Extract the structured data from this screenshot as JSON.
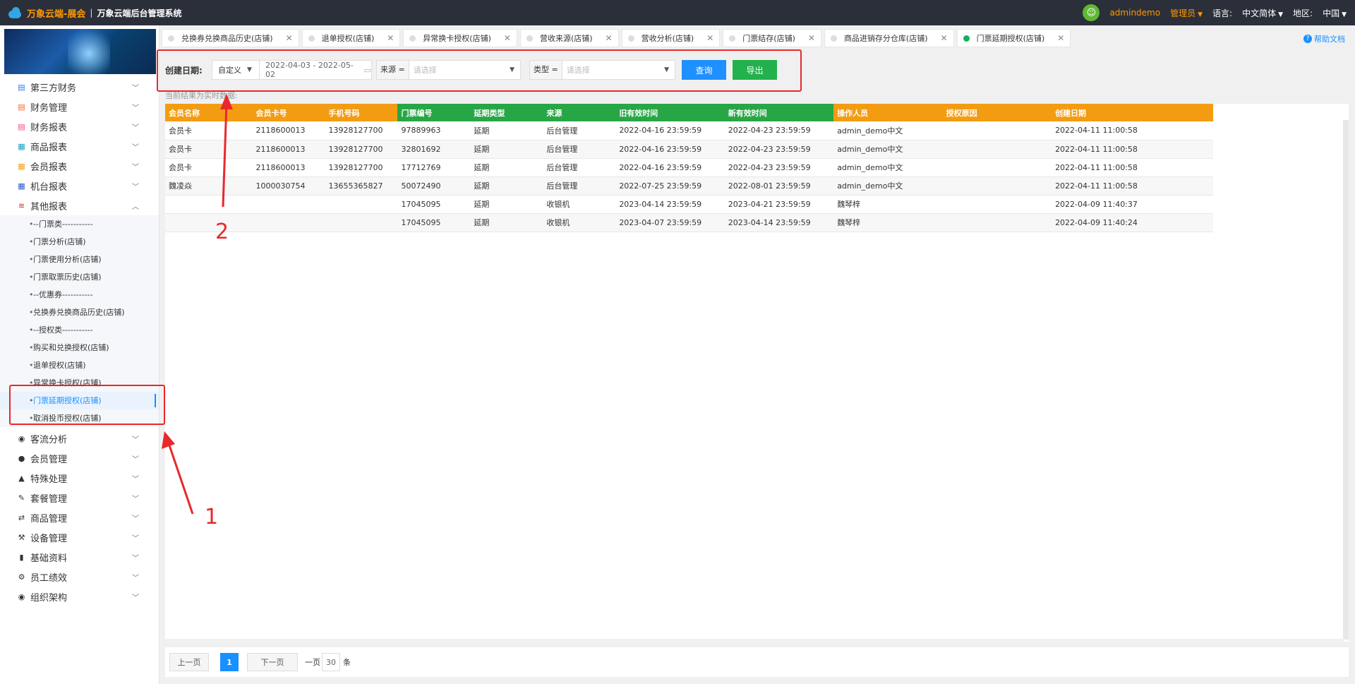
{
  "header": {
    "brand": "万象云端-展会",
    "separator": "|",
    "system_name": "万象云端后台管理系统",
    "avatar_glyph": "☺",
    "username": "admindemo",
    "role": "管理员",
    "language_label": "语言:",
    "language_value": "中文简体",
    "region_label": "地区:",
    "region_value": "中国"
  },
  "sidebar": {
    "menu_top": [
      {
        "label": "第三方财务",
        "icon": "document-icon",
        "color": "#2f7fe8"
      },
      {
        "label": "财务管理",
        "icon": "ledger-icon",
        "color": "#ef6a2b"
      },
      {
        "label": "财务报表",
        "icon": "report-icon",
        "color": "#e84b7a"
      },
      {
        "label": "商品报表",
        "icon": "chart-icon",
        "color": "#17a2b8"
      },
      {
        "label": "会员报表",
        "icon": "member-icon",
        "color": "#f0a020"
      },
      {
        "label": "机台报表",
        "icon": "machine-icon",
        "color": "#2659c9"
      },
      {
        "label": "其他报表",
        "icon": "layers-icon",
        "color": "#c0392b"
      }
    ],
    "sub_items": [
      "--门票类-----------",
      "门票分析(店铺)",
      "门票使用分析(店铺)",
      "门票取票历史(店铺)",
      "--优惠券-----------",
      "兑换券兑换商品历史(店铺)",
      "--授权类-----------",
      "购买和兑换授权(店铺)",
      "退单授权(店铺)",
      "异常换卡授权(店铺)",
      "门票延期授权(店铺)",
      "取消投币授权(店铺)"
    ],
    "active_sub_index": 10,
    "menu_bottom": [
      {
        "label": "客流分析",
        "icon": "target-icon"
      },
      {
        "label": "会员管理",
        "icon": "user-icon"
      },
      {
        "label": "特殊处理",
        "icon": "warning-icon"
      },
      {
        "label": "套餐管理",
        "icon": "edit-icon"
      },
      {
        "label": "商品管理",
        "icon": "swap-icon"
      },
      {
        "label": "设备管理",
        "icon": "wrench-icon"
      },
      {
        "label": "基础资料",
        "icon": "file-icon"
      },
      {
        "label": "员工绩效",
        "icon": "gear-icon"
      },
      {
        "label": "组织架构",
        "icon": "radio-icon"
      }
    ]
  },
  "tabs": [
    {
      "label": "兑换券兑换商品历史(店铺)",
      "active": false
    },
    {
      "label": "退单授权(店铺)",
      "active": false
    },
    {
      "label": "异常换卡授权(店铺)",
      "active": false
    },
    {
      "label": "营收来源(店铺)",
      "active": false
    },
    {
      "label": "营收分析(店铺)",
      "active": false
    },
    {
      "label": "门票结存(店铺)",
      "active": false
    },
    {
      "label": "商品进销存分仓库(店铺)",
      "active": false
    },
    {
      "label": "门票延期授权(店铺)",
      "active": true
    }
  ],
  "help_label": "帮助文档",
  "filters": {
    "date_label": "创建日期:",
    "date_mode": "自定义",
    "date_range": "2022-04-03 - 2022-05-02",
    "source_label": "来源 =",
    "source_placeholder": "请选择",
    "type_label": "类型 =",
    "type_placeholder": "请选择",
    "query_button": "查询",
    "export_button": "导出"
  },
  "hint": "当前结果为实时数据:",
  "table": {
    "columns": [
      {
        "label": "会员名称",
        "color": "#f39c12"
      },
      {
        "label": "会员卡号",
        "color": "#f39c12"
      },
      {
        "label": "手机号码",
        "color": "#f39c12"
      },
      {
        "label": "门票编号",
        "color": "#27a645"
      },
      {
        "label": "延期类型",
        "color": "#27a645"
      },
      {
        "label": "来源",
        "color": "#27a645"
      },
      {
        "label": "旧有效时间",
        "color": "#27a645"
      },
      {
        "label": "新有效时间",
        "color": "#27a645"
      },
      {
        "label": "操作人员",
        "color": "#f39c12"
      },
      {
        "label": "授权原因",
        "color": "#f39c12"
      },
      {
        "label": "创建日期",
        "color": "#f39c12"
      }
    ],
    "rows": [
      [
        "会员卡",
        "2118600013",
        "13928127700",
        "97889963",
        "延期",
        "后台管理",
        "2022-04-16 23:59:59",
        "2022-04-23 23:59:59",
        "admin_demo中文",
        "",
        "2022-04-11 11:00:58"
      ],
      [
        "会员卡",
        "2118600013",
        "13928127700",
        "32801692",
        "延期",
        "后台管理",
        "2022-04-16 23:59:59",
        "2022-04-23 23:59:59",
        "admin_demo中文",
        "",
        "2022-04-11 11:00:58"
      ],
      [
        "会员卡",
        "2118600013",
        "13928127700",
        "17712769",
        "延期",
        "后台管理",
        "2022-04-16 23:59:59",
        "2022-04-23 23:59:59",
        "admin_demo中文",
        "",
        "2022-04-11 11:00:58"
      ],
      [
        "魏凌焱",
        "1000030754",
        "13655365827",
        "50072490",
        "延期",
        "后台管理",
        "2022-07-25 23:59:59",
        "2022-08-01 23:59:59",
        "admin_demo中文",
        "",
        "2022-04-11 11:00:58"
      ],
      [
        "",
        "",
        "",
        "17045095",
        "延期",
        "收银机",
        "2023-04-14 23:59:59",
        "2023-04-21 23:59:59",
        "魏琴梓",
        "",
        "2022-04-09 11:40:37"
      ],
      [
        "",
        "",
        "",
        "17045095",
        "延期",
        "收银机",
        "2023-04-07 23:59:59",
        "2023-04-14 23:59:59",
        "魏琴梓",
        "",
        "2022-04-09 11:40:24"
      ]
    ]
  },
  "pager": {
    "prev": "上一页",
    "current": "1",
    "next": "下一页",
    "per_page_label": "一页",
    "per_page_value": "30",
    "unit": "条"
  },
  "annotations": {
    "label_1": "1",
    "label_2": "2",
    "color": "#e8282b"
  }
}
